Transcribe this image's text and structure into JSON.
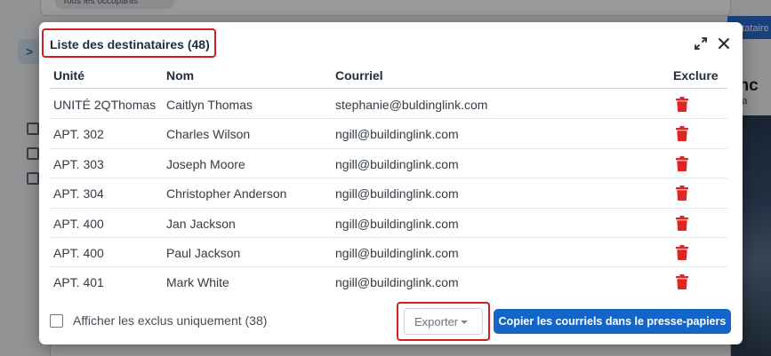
{
  "background": {
    "chip_label": "Tous les occupants",
    "right_tab_label": "ntataire",
    "right_heading_fragment": "enc",
    "right_sub_fragment": "rida"
  },
  "modal": {
    "title": "Liste des destinataires (48)",
    "columns": {
      "unit": "Unité",
      "name": "Nom",
      "email": "Courriel",
      "exclude": "Exclure"
    },
    "rows": [
      {
        "unit": "UNITÉ 2QThomas",
        "name": "Caitlyn Thomas",
        "email": "stephanie@buldinglink.com"
      },
      {
        "unit": "APT. 302",
        "name": "Charles Wilson",
        "email": "ngill@buildinglink.com"
      },
      {
        "unit": "APT. 303",
        "name": "Joseph Moore",
        "email": "ngill@buildinglink.com"
      },
      {
        "unit": "APT. 304",
        "name": "Christopher Anderson",
        "email": "ngill@buildinglink.com"
      },
      {
        "unit": "APT. 400",
        "name": "Jan Jackson",
        "email": "ngill@buildinglink.com"
      },
      {
        "unit": "APT. 400",
        "name": "Paul Jackson",
        "email": "ngill@buildinglink.com"
      },
      {
        "unit": "APT. 401",
        "name": "Mark White",
        "email": "ngill@buildinglink.com"
      }
    ],
    "footer": {
      "show_excluded_label": "Afficher les exclus uniquement (38)",
      "show_excluded_checked": false,
      "export_label": "Exporter",
      "copy_label": "Copier les courriels dans le presse-papiers"
    }
  },
  "colors": {
    "accent": "#1565c8",
    "trash": "#e02424",
    "highlight_box": "#d02020"
  }
}
